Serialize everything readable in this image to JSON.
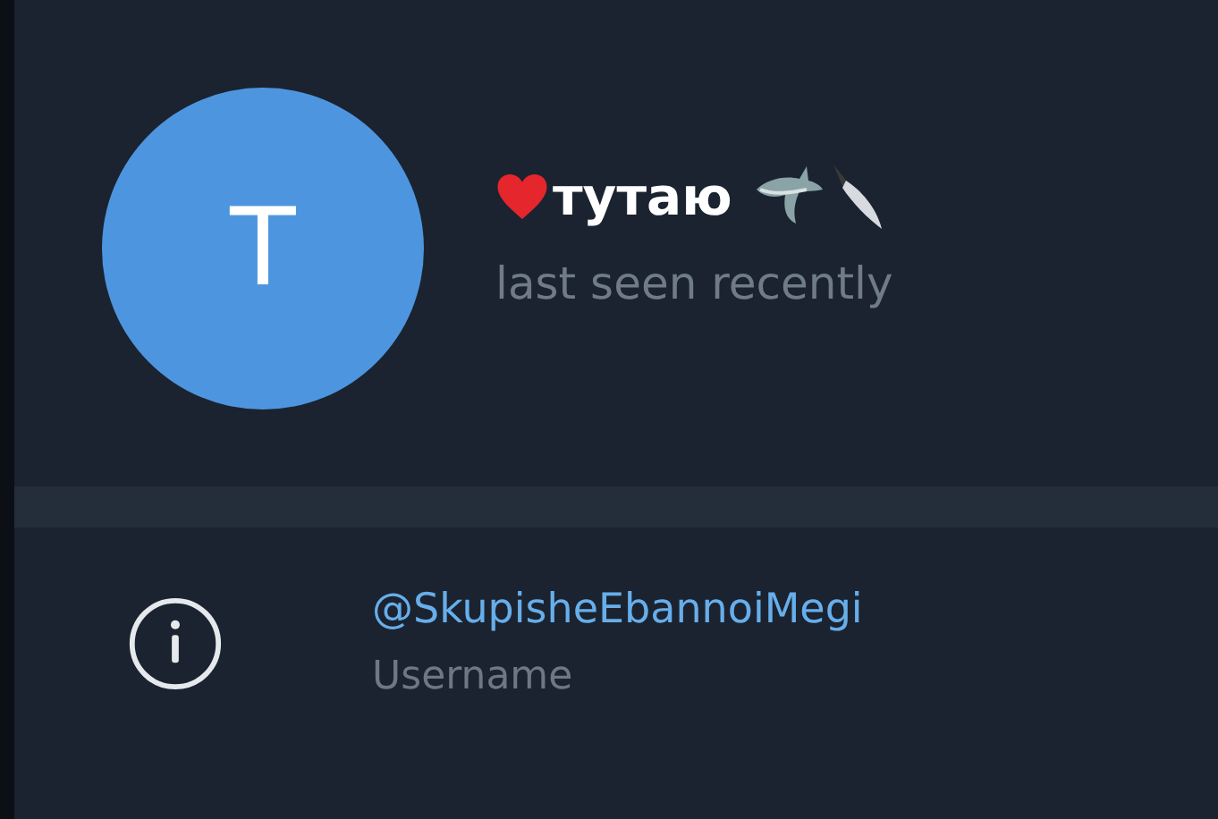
{
  "profile": {
    "avatar_letter": "T",
    "name": "тутаю",
    "status": "last seen recently"
  },
  "info": [
    {
      "kind": "username",
      "value": "@SkupisheEbannoiMegi",
      "label": "Username"
    }
  ]
}
